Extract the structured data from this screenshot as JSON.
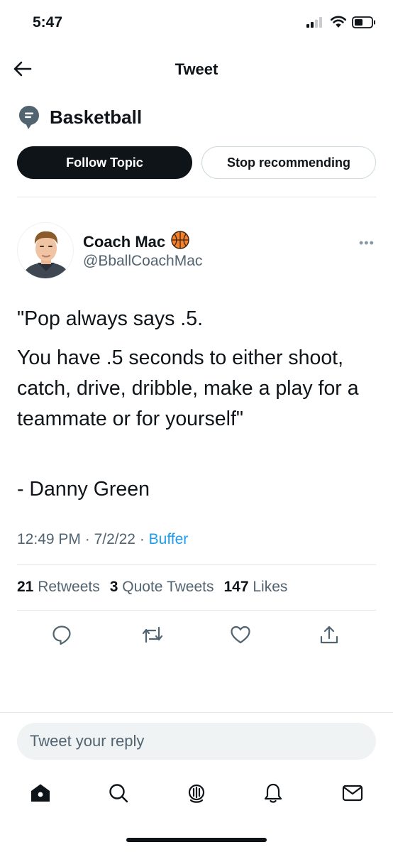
{
  "status_bar": {
    "time": "5:47"
  },
  "header": {
    "title": "Tweet",
    "back_icon": "arrow-left-icon"
  },
  "topic": {
    "name": "Basketball",
    "icon": "topic-icon",
    "follow_label": "Follow Topic",
    "stop_label": "Stop recommending"
  },
  "author": {
    "name": "Coach Mac",
    "emoji": "🏀",
    "handle": "@BballCoachMac"
  },
  "tweet": {
    "paragraphs": [
      "\"Pop always says .5.",
      "You have .5 seconds to either shoot, catch, drive, dribble, make a play for a teammate or for yourself\"",
      "- Danny Green"
    ],
    "time": "12:49 PM",
    "date": "7/2/22",
    "separator": "·",
    "source": "Buffer"
  },
  "stats": {
    "retweets_count": "21",
    "retweets_label": "Retweets",
    "quotes_count": "3",
    "quotes_label": "Quote Tweets",
    "likes_count": "147",
    "likes_label": "Likes"
  },
  "reply": {
    "placeholder": "Tweet your reply"
  },
  "colors": {
    "accent": "#1d9bf0",
    "text": "#0f1419",
    "muted": "#536471",
    "divider": "#e1e6ea",
    "input_bg": "#eff3f4"
  }
}
